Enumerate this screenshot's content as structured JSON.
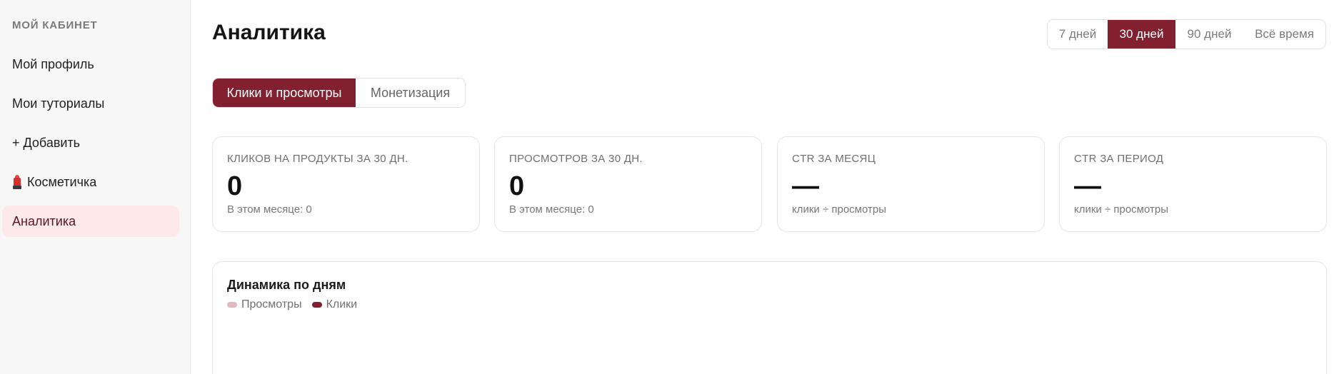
{
  "sidebar": {
    "heading": "МОЙ КАБИНЕТ",
    "items": [
      {
        "label": "Мой профиль"
      },
      {
        "label": "Мои туториалы"
      },
      {
        "label": "+ Добавить"
      },
      {
        "label": "Косметичка",
        "icon": "lipstick-icon"
      },
      {
        "label": "Аналитика",
        "active": true
      }
    ]
  },
  "header": {
    "title": "Аналитика",
    "periods": [
      "7 дней",
      "30 дней",
      "90 дней",
      "Всё время"
    ],
    "active_period": "30 дней"
  },
  "tabs": {
    "items": [
      "Клики и просмотры",
      "Монетизация"
    ],
    "active": "Клики и просмотры"
  },
  "stats": [
    {
      "label": "КЛИКОВ НА ПРОДУКТЫ ЗА 30 ДН.",
      "value": "0",
      "sub": "В этом месяце: 0"
    },
    {
      "label": "ПРОСМОТРОВ ЗА 30 ДН.",
      "value": "0",
      "sub": "В этом месяце: 0"
    },
    {
      "label": "CTR ЗА МЕСЯЦ",
      "value": "—",
      "sub": "клики ÷ просмотры"
    },
    {
      "label": "CTR ЗА ПЕРИОД",
      "value": "—",
      "sub": "клики ÷ просмотры"
    }
  ],
  "chart": {
    "title": "Динамика по дням",
    "legend": [
      {
        "name": "Просмотры",
        "color": "#e0b8bd"
      },
      {
        "name": "Клики",
        "color": "#83202f"
      }
    ]
  },
  "colors": {
    "accent": "#83202f",
    "active_sidebar_bg": "#fde9ea"
  }
}
